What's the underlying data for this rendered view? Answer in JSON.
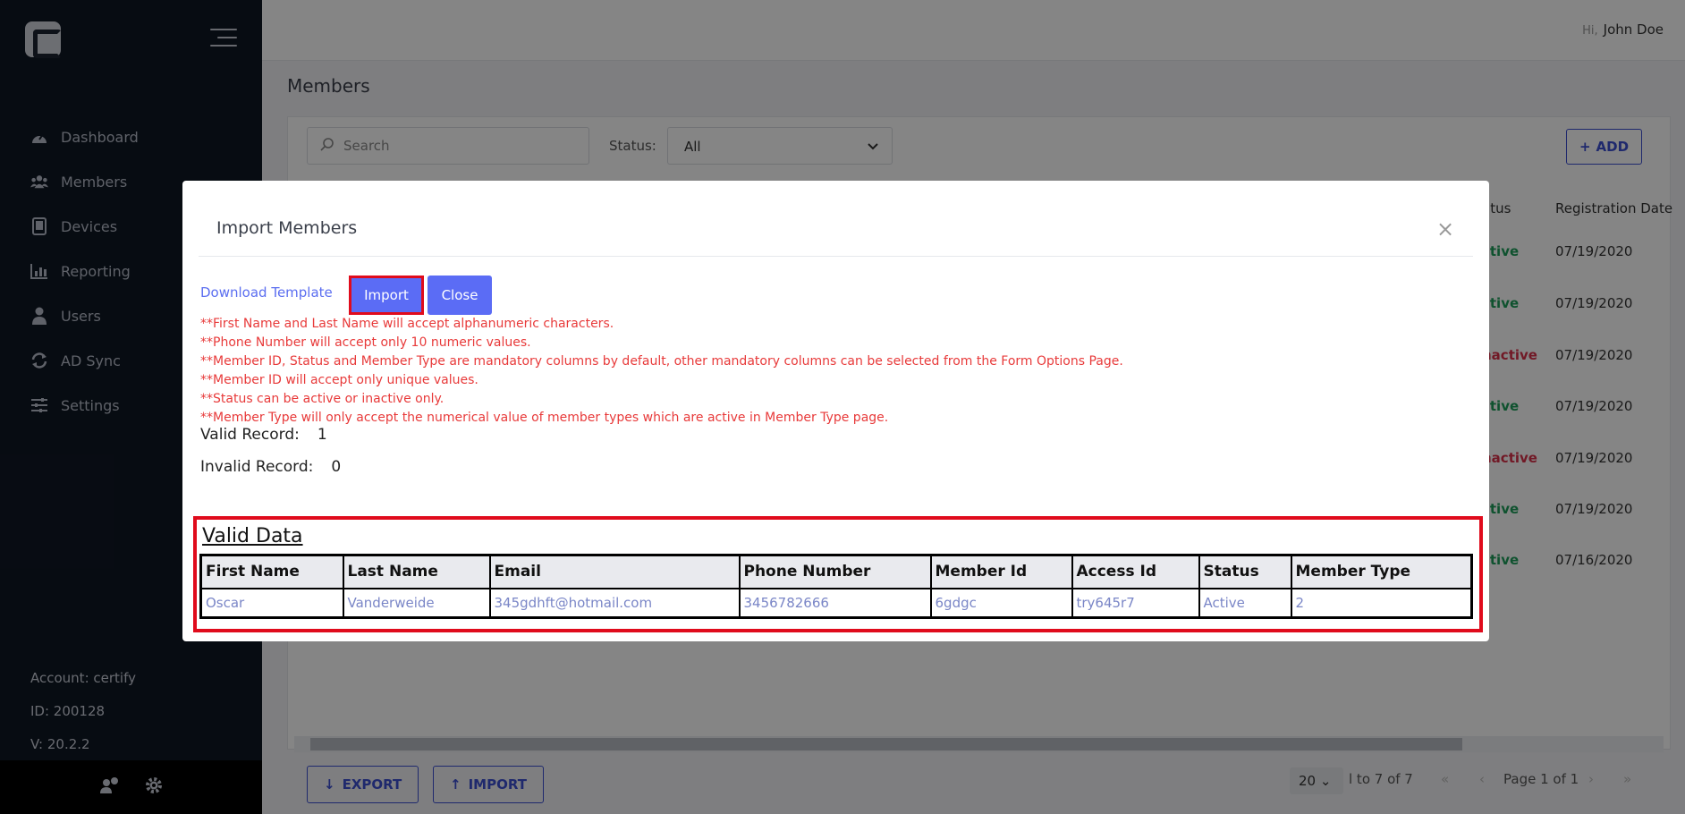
{
  "sidebar": {
    "items": [
      {
        "label": "Dashboard",
        "icon": "dashboard-icon"
      },
      {
        "label": "Members",
        "icon": "members-icon"
      },
      {
        "label": "Devices",
        "icon": "devices-icon"
      },
      {
        "label": "Reporting",
        "icon": "reporting-icon"
      },
      {
        "label": "Users",
        "icon": "users-icon"
      },
      {
        "label": "AD Sync",
        "icon": "sync-icon"
      },
      {
        "label": "Settings",
        "icon": "settings-icon"
      }
    ],
    "account": "Account: certify",
    "id": "ID: 200128",
    "version": "V: 20.2.2"
  },
  "header": {
    "hi": "Hi,",
    "user": "John Doe"
  },
  "page": {
    "title": "Members"
  },
  "filters": {
    "search_placeholder": "Search",
    "status_label": "Status:",
    "status_value": "All",
    "add_label": "ADD"
  },
  "background_table": {
    "status_header": "atus",
    "date_header": "Registration Date",
    "rows": [
      {
        "status": "ctive",
        "date": "07/19/2020"
      },
      {
        "status": "ctive",
        "date": "07/19/2020"
      },
      {
        "status": "nactive",
        "date": "07/19/2020"
      },
      {
        "status": "ctive",
        "date": "07/19/2020"
      },
      {
        "status": "nactive",
        "date": "07/19/2020"
      },
      {
        "status": "ctive",
        "date": "07/19/2020"
      },
      {
        "status": "ctive",
        "date": "07/16/2020"
      }
    ]
  },
  "footer": {
    "export_label": "EXPORT",
    "import_label": "IMPORT",
    "page_size": "20",
    "range": "l to 7 of 7",
    "page": "Page 1 of 1"
  },
  "modal": {
    "title": "Import Members",
    "close_symbol": "×",
    "download_template": "Download Template",
    "import_button": "Import",
    "close_button": "Close",
    "rules": [
      "**First Name and Last Name will accept alphanumeric characters.",
      "**Phone Number will accept only 10 numeric values.",
      "**Member ID, Status and Member Type are mandatory columns by default, other mandatory columns can be selected from the Form Options Page.",
      "**Member ID will accept only unique values.",
      "**Status can be active or inactive only.",
      "**Member Type will only accept the numerical value of member types which are active in Member Type page."
    ],
    "valid_record_label": "Valid Record:",
    "valid_record_value": "1",
    "invalid_record_label": "Invalid Record:",
    "invalid_record_value": "0",
    "valid_data_title": "Valid Data",
    "table_headers": [
      "First Name",
      "Last Name",
      "Email",
      "Phone Number",
      "Member Id",
      "Access Id",
      "Status",
      "Member Type"
    ],
    "table_rows": [
      [
        "Oscar",
        "Vanderweide",
        "345gdhft@hotmail.com",
        "3456782666",
        "6gdgc",
        "try645r7",
        "Active",
        "2"
      ]
    ]
  },
  "colors": {
    "sidebar": "#0f1724",
    "accent": "#5b6cf5",
    "highlight": "#e00b1c",
    "rule_text": "#e83a3a"
  }
}
